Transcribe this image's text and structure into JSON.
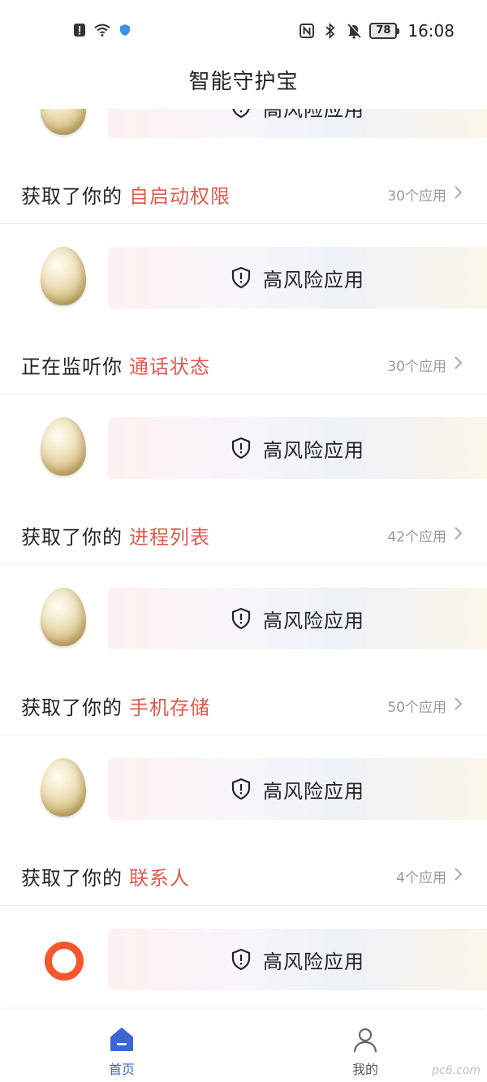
{
  "status_bar": {
    "battery": "78",
    "time": "16:08"
  },
  "header": {
    "title": "智能守护宝"
  },
  "banner_label": "高风险应用",
  "permissions": [
    {
      "prefix": "获取了你的",
      "highlight": "自启动权限",
      "count": "30个应用"
    },
    {
      "prefix": "正在监听你",
      "highlight": "通话状态",
      "count": "30个应用"
    },
    {
      "prefix": "获取了你的",
      "highlight": "进程列表",
      "count": "42个应用"
    },
    {
      "prefix": "获取了你的",
      "highlight": "手机存储",
      "count": "50个应用"
    },
    {
      "prefix": "获取了你的",
      "highlight": "联系人",
      "count": "4个应用"
    }
  ],
  "bottom_nav": {
    "home_label": "首页",
    "mine_label": "我的"
  },
  "watermark": "pc6.com",
  "colors": {
    "highlight": "#e05a4f",
    "accent": "#3b66d8",
    "ring": "#f4562d"
  }
}
